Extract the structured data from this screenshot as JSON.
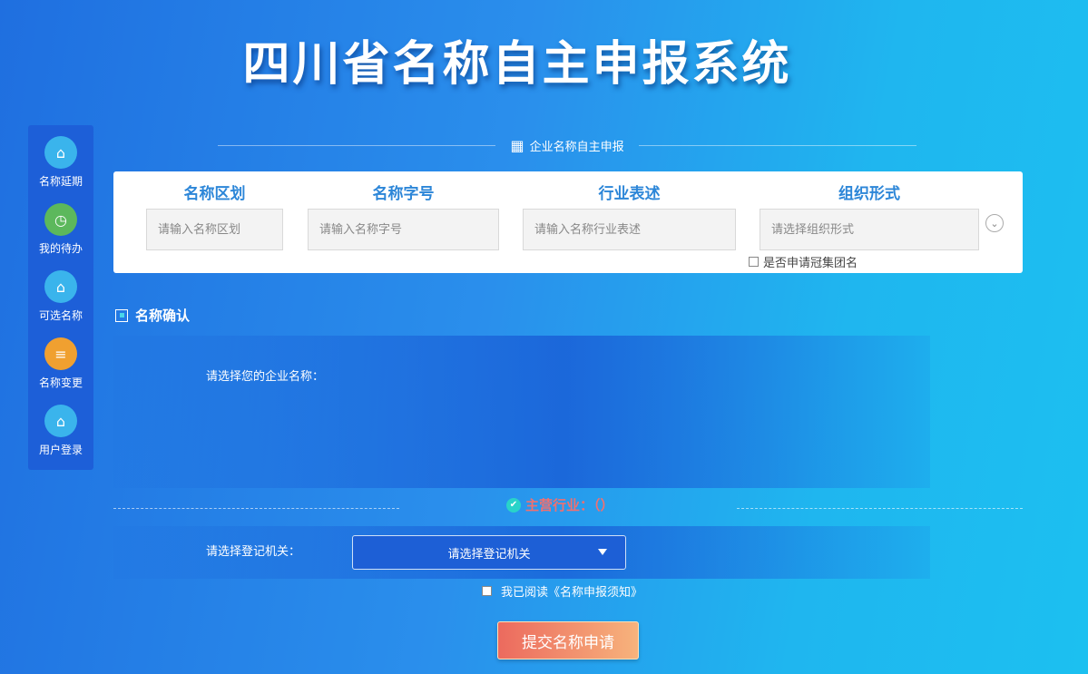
{
  "header": {
    "title": "四川省名称自主申报系统"
  },
  "sidebar": {
    "items": [
      {
        "label": "名称延期",
        "icon": "home-icon"
      },
      {
        "label": "我的待办",
        "icon": "clock-icon"
      },
      {
        "label": "可选名称",
        "icon": "home-icon"
      },
      {
        "label": "名称变更",
        "icon": "list-icon"
      },
      {
        "label": "用户登录",
        "icon": "home-icon"
      }
    ]
  },
  "section": {
    "title": "企业名称自主申报",
    "icon": "building-icon"
  },
  "form": {
    "region": {
      "label": "名称区划",
      "placeholder": "请输入名称区划"
    },
    "trade_name": {
      "label": "名称字号",
      "placeholder": "请输入名称字号"
    },
    "industry": {
      "label": "行业表述",
      "placeholder": "请输入名称行业表述"
    },
    "org_form": {
      "label": "组织形式",
      "placeholder": "请选择组织形式"
    },
    "group_name_checkbox": "是否申请冠集团名"
  },
  "confirm": {
    "title": "名称确认",
    "choose_label": "请选择您的企业名称："
  },
  "industry_main": {
    "label": "主营行业：（）"
  },
  "registration": {
    "label": "请选择登记机关：",
    "select_value": "请选择登记机关"
  },
  "agreement": {
    "label": "我已阅读《名称申报须知》"
  },
  "submit": {
    "label": "提交名称申请"
  },
  "colors": {
    "background_start": "#1f6fe0",
    "background_end": "#1cc0f0",
    "label_blue": "#2c86d8",
    "submit_start": "#ec6a5e",
    "submit_end": "#f7b37c",
    "industry_red": "#f07070"
  }
}
